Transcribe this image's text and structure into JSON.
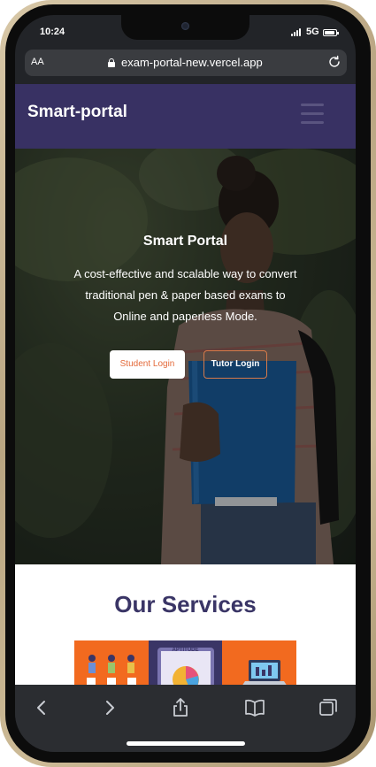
{
  "status_bar": {
    "time": "10:24",
    "network": "5G"
  },
  "browser": {
    "text_size_label": "AA",
    "url": "exam-portal-new.vercel.app"
  },
  "site": {
    "brand": "Smart-portal",
    "hero": {
      "title": "Smart Portal",
      "description": "A cost-effective and scalable way to convert traditional pen & paper based exams to Online and paperless Mode.",
      "student_login": "Student Login",
      "tutor_login": "Tutor Login"
    },
    "services": {
      "title": "Our Services",
      "tiles": [
        {
          "name": "services-illustration",
          "color": "#f26a1f"
        },
        {
          "name": "aptitude-illustration",
          "label": "APTITUDE",
          "color": "#3a3566"
        },
        {
          "name": "laptop-illustration",
          "color": "#f26a1f"
        }
      ]
    }
  },
  "toolbar": [
    "back-icon",
    "forward-icon",
    "share-icon",
    "bookmarks-icon",
    "tabs-icon"
  ],
  "colors": {
    "navbar": "#383163",
    "accent": "#e46a3a",
    "heading": "#3a3566"
  }
}
